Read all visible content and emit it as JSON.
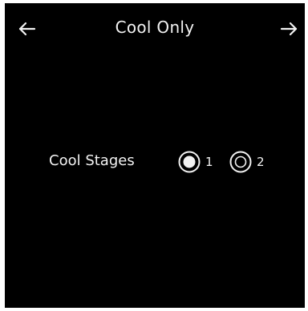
{
  "header": {
    "title": "Cool Only",
    "back_icon": "arrow-left-icon",
    "next_icon": "arrow-right-icon"
  },
  "cool_stages": {
    "label": "Cool Stages",
    "selected": "1",
    "options": [
      {
        "label": "1",
        "selected": true
      },
      {
        "label": "2",
        "selected": false
      }
    ]
  },
  "colors": {
    "background": "#000000",
    "foreground": "#f2f2f2"
  }
}
